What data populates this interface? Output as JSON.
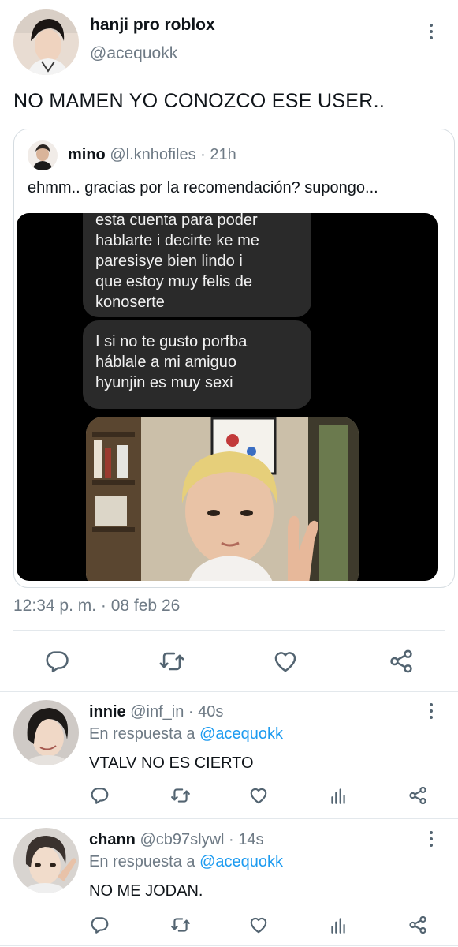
{
  "main": {
    "name": "hanji pro roblox",
    "handle": "@acequokk",
    "text": "NO MAMEN YO CONOZCO ESE USER..",
    "timestamp": "12:34 p. m. · 08 feb 26"
  },
  "quote": {
    "name": "mino",
    "handle": "@l.knhofiles",
    "time": "· 21h",
    "text": "ehmm.. gracias por la recomendación? supongo...",
    "media": {
      "bubble_1": "esta cuenta para poder\nhablarte i decirte ke me\nparesisye bien lindo i\nque estoy muy felis de\nkonoserte",
      "bubble_2": "I si no te gusto porfba\nháblale a mi amiguo\nhyunjin es muy sexi"
    }
  },
  "replies": [
    {
      "name": "innie",
      "handle": "@inf_in",
      "time": "· 40s",
      "reply_prefix": "En respuesta a",
      "reply_to": "@acequokk",
      "text": "VTALV NO ES CIERTO"
    },
    {
      "name": "chann",
      "handle": "@cb97slywl",
      "time": "· 14s",
      "reply_prefix": "En respuesta a",
      "reply_to": "@acequokk",
      "text": "NO ME JODAN."
    }
  ],
  "icons": {
    "reply": "reply-icon",
    "retweet": "retweet-icon",
    "like": "heart-icon",
    "share": "share-icon",
    "analytics": "analytics-icon",
    "more": "more-vertical-icon"
  },
  "colors": {
    "text": "#0f1419",
    "secondary": "#6e7a85",
    "link": "#1d9bf0",
    "divider": "#e3e8ec"
  }
}
